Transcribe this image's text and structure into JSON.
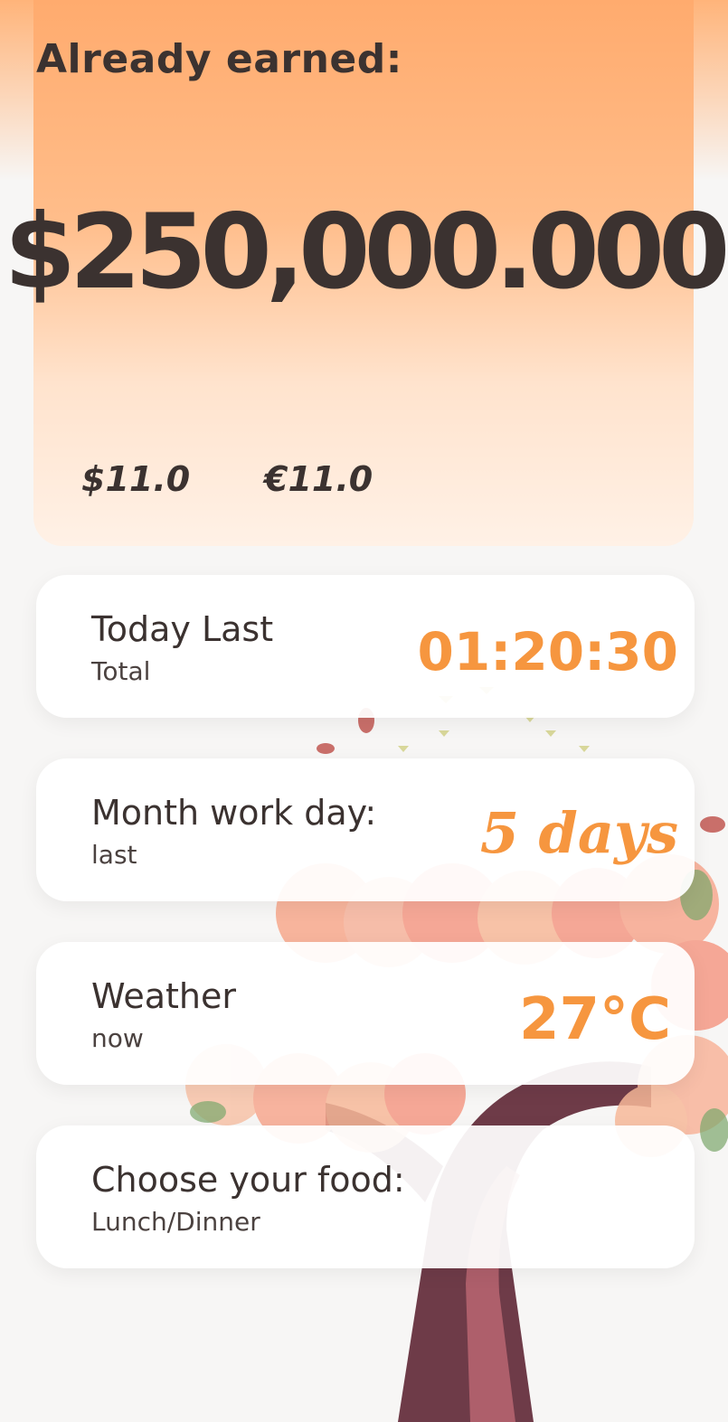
{
  "earnings": {
    "label": "Already earned:",
    "amount": "$250,000.000",
    "rate_usd": "$11.0",
    "rate_eur": "€11.0"
  },
  "cards": [
    {
      "title": "Today Last",
      "subtitle": "Total",
      "value": "01:20:30"
    },
    {
      "title": "Month work day:",
      "subtitle": "last",
      "value": "5 days"
    },
    {
      "title": "Weather",
      "subtitle": "now",
      "value": "27°C"
    },
    {
      "title": "Choose your food:",
      "subtitle": "Lunch/Dinner",
      "value": ""
    }
  ],
  "colors": {
    "accent": "#f6963f",
    "header_gradient_top": "#ffab6e",
    "text": "#3b3230",
    "background": "#f7f6f5"
  },
  "icons": {
    "background": "cherry-blossom-tree-illustration"
  }
}
